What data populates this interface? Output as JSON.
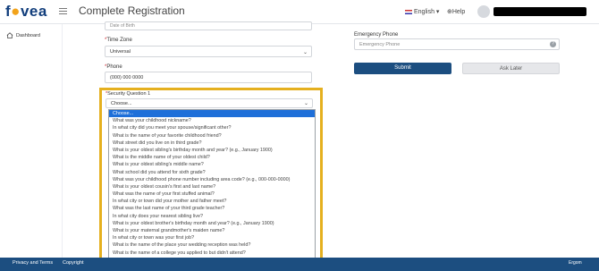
{
  "header": {
    "logo_text": "f",
    "logo_rest": "vea",
    "title": "Complete Registration",
    "language": "English",
    "help": "Help",
    "username": ""
  },
  "sidebar": {
    "items": [
      {
        "label": "Dashboard",
        "icon": "home-icon"
      }
    ]
  },
  "form": {
    "dob_placeholder": "Date of Birth",
    "timezone": {
      "label": "Time Zone",
      "value": "Universal"
    },
    "phone": {
      "label": "Phone",
      "value": "(000) 000 0000"
    },
    "security_question": {
      "label": "Security Question 1",
      "value": "Choose..."
    },
    "emergency_phone": {
      "label": "Emergency Phone",
      "placeholder": "Emergency Phone"
    },
    "submit_label": "Submit",
    "ask_later_label": "Ask Later"
  },
  "dropdown_options": [
    "Choose...",
    "What was your childhood nickname?",
    "In what city did you meet your spouse/significant other?",
    "What is the name of your favorite childhood friend?",
    "What street did you live on in third grade?",
    "What is your oldest sibling's birthday month and year? (e.g., January 1900)",
    "What is the middle name of your oldest child?",
    "What is your oldest sibling's middle name?",
    "What school did you attend for sixth grade?",
    "What was your childhood phone number including area code? (e.g., 000-000-0000)",
    "What is your oldest cousin's first and last name?",
    "What was the name of your first stuffed animal?",
    "In what city or town did your mother and father meet?",
    "What was the last name of your third grade teacher?",
    "In what city does your nearest sibling live?",
    "What is your oldest brother's birthday month and year? (e.g., January 1900)",
    "What is your maternal grandmother's maiden name?",
    "In what city or town was your first job?",
    "What is the name of the place your wedding reception was held?",
    "What is the name of a college you applied to but didn't attend?"
  ],
  "footer": {
    "privacy_terms": "Privacy and Terms",
    "copyright": "Copyright",
    "brand": "Ergom"
  },
  "colors": {
    "primary": "#1c4e80",
    "highlight": "#e5b01f",
    "selected": "#1e6fd9",
    "required": "#d0282e"
  }
}
